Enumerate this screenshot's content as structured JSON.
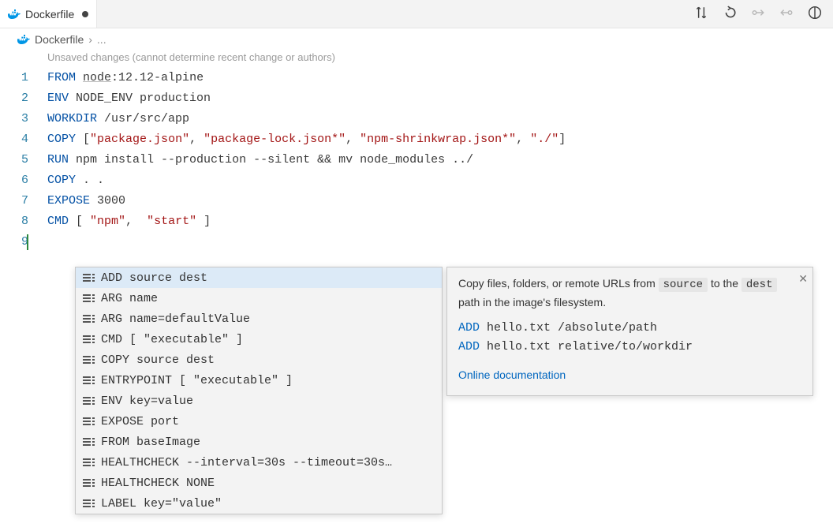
{
  "tab": {
    "filename": "Dockerfile",
    "modified": true
  },
  "breadcrumb": {
    "filename": "Dockerfile",
    "sep": "›",
    "ellipsis": "..."
  },
  "hint": "Unsaved changes (cannot determine recent change or authors)",
  "code": {
    "l1": {
      "kw": "FROM",
      "img": "node",
      "tag": ":12.12-alpine"
    },
    "l2": {
      "kw": "ENV",
      "rest": "NODE_ENV production"
    },
    "l3": {
      "kw": "WORKDIR",
      "rest": "/usr/src/app"
    },
    "l4": {
      "kw": "COPY",
      "b1": "[",
      "s1": "\"package.json\"",
      "c": ", ",
      "s2": "\"package-lock.json*\"",
      "s3": "\"npm-shrinkwrap.json*\"",
      "s4": "\"./\"",
      "b2": "]"
    },
    "l5": {
      "kw": "RUN",
      "rest": "npm install --production --silent && mv node_modules ../"
    },
    "l6": {
      "kw": "COPY",
      "rest": ". ."
    },
    "l7": {
      "kw": "EXPOSE",
      "rest": "3000"
    },
    "l8": {
      "kw": "CMD",
      "b1": "[ ",
      "s1": "\"npm\"",
      "c": ",  ",
      "s2": "\"start\"",
      "b2": " ]"
    }
  },
  "lineNumbers": [
    "1",
    "2",
    "3",
    "4",
    "5",
    "6",
    "7",
    "8",
    "9"
  ],
  "suggestions": [
    "ADD source dest",
    "ARG name",
    "ARG name=defaultValue",
    "CMD [ \"executable\" ]",
    "COPY source dest",
    "ENTRYPOINT [ \"executable\" ]",
    "ENV key=value",
    "EXPOSE port",
    "FROM baseImage",
    "HEALTHCHECK --interval=30s --timeout=30s…",
    "HEALTHCHECK NONE",
    "LABEL key=\"value\""
  ],
  "doc": {
    "pre": "Copy files, folders, or remote URLs from ",
    "src": "source",
    "mid": " to the ",
    "dst": "dest",
    "post": " path in the image's filesystem.",
    "ex1_kw": "ADD",
    "ex1_rest": " hello.txt /absolute/path",
    "ex2_kw": "ADD",
    "ex2_rest": " hello.txt relative/to/workdir",
    "link": "Online documentation"
  },
  "toolbarTooltips": {
    "compare": "Compare changes",
    "revert": "Revert",
    "prev": "Previous change",
    "next": "Next change",
    "split": "Split editor"
  }
}
